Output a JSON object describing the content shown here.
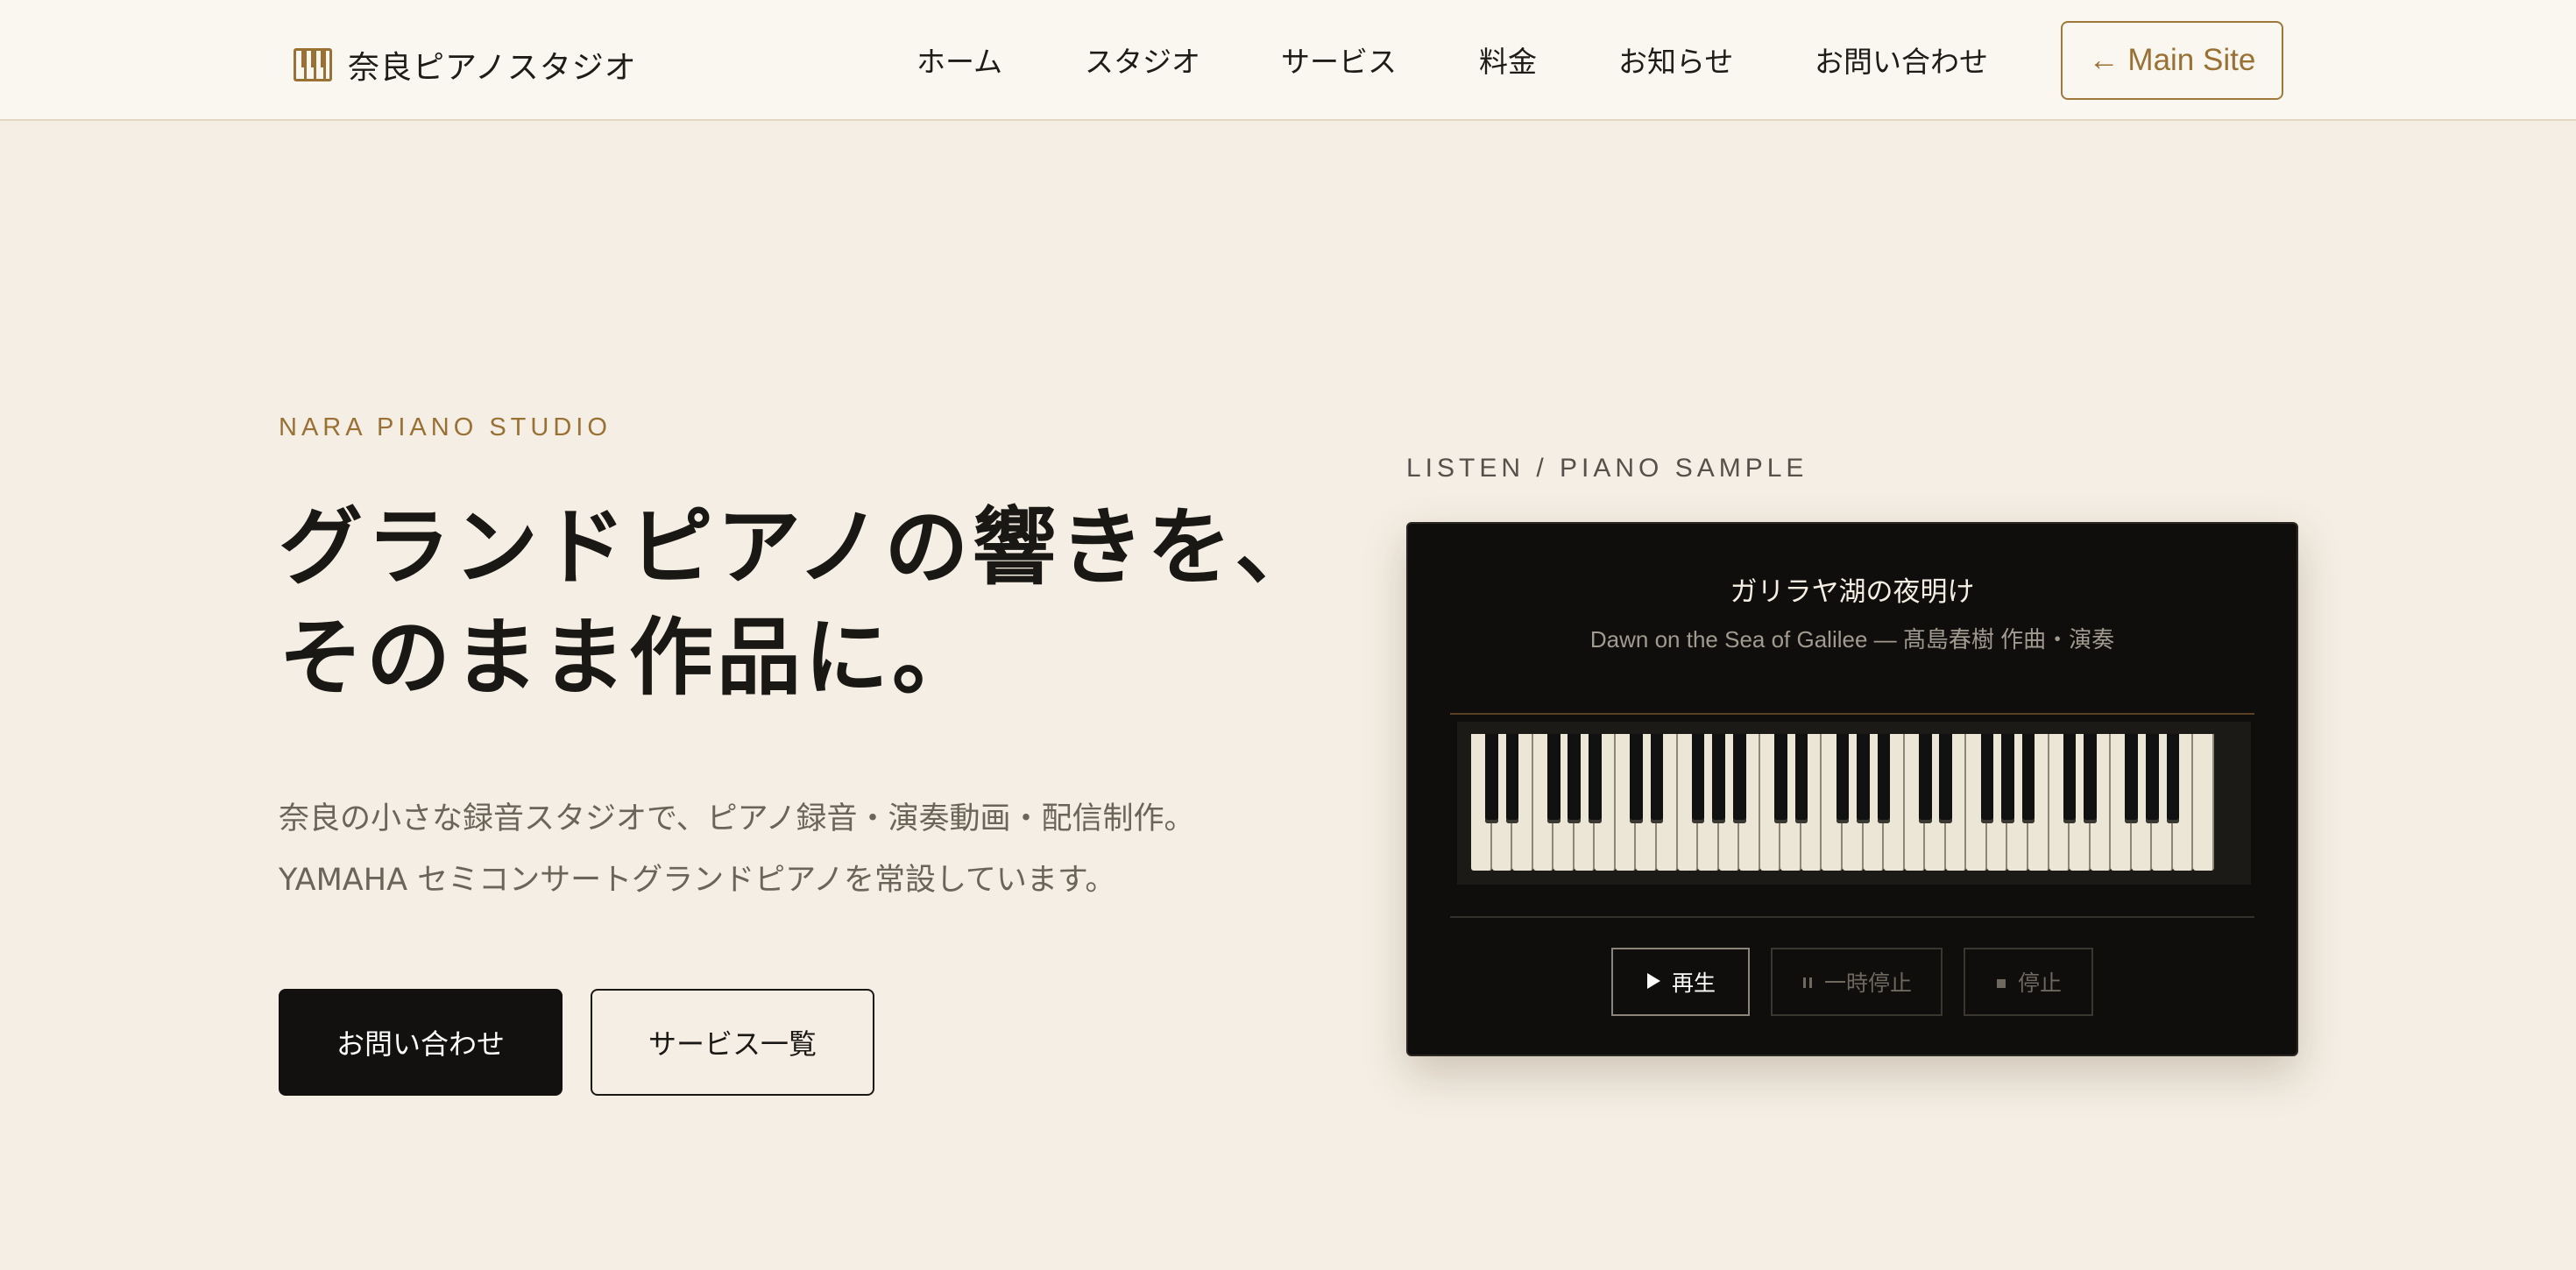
{
  "header": {
    "logo_text": "奈良ピアノスタジオ",
    "logo_icon": "piano-keys-icon",
    "nav": [
      {
        "label": "ホーム",
        "name": "nav-home"
      },
      {
        "label": "スタジオ",
        "name": "nav-studio"
      },
      {
        "label": "サービス",
        "name": "nav-services"
      },
      {
        "label": "料金",
        "name": "nav-pricing"
      },
      {
        "label": "お知らせ",
        "name": "nav-news"
      },
      {
        "label": "お問い合わせ",
        "name": "nav-contact"
      }
    ],
    "main_site_label": "← Main Site"
  },
  "hero": {
    "eyebrow": "NARA PIANO STUDIO",
    "title_line1": "グランドピアノの響きを、",
    "title_line2": "そのまま作品に。",
    "desc_line1": "奈良の小さな録音スタジオで、ピアノ録音・演奏動画・配信制作。",
    "desc_line2": "YAMAHA セミコンサートグランドピアノを常設しています。",
    "primary_button": "お問い合わせ",
    "secondary_button": "サービス一覧"
  },
  "player": {
    "section_label": "LISTEN / PIANO SAMPLE",
    "track_title": "ガリラヤ湖の夜明け",
    "track_subtitle": "Dawn on the Sea of Galilee — 髙島春樹 作曲・演奏",
    "controls": {
      "play": "再生",
      "pause": "一時停止",
      "stop": "停止"
    },
    "icons": {
      "play": "play-icon",
      "pause": "pause-icon",
      "stop": "stop-icon"
    },
    "white_keys": 36
  },
  "colors": {
    "background": "#f5eee4",
    "header_bg": "#faf7f1",
    "accent": "#9a7133",
    "dark": "#12110f",
    "muted_text": "#6b6458"
  }
}
